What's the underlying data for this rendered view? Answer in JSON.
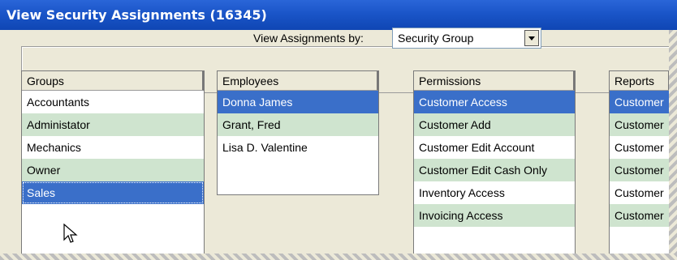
{
  "window": {
    "title": "View Security Assignments (16345)"
  },
  "view": {
    "label": "View Assignments by:",
    "selected": "Security Group"
  },
  "groups": {
    "header": "Groups",
    "items": [
      "Accountants",
      "Administator",
      "Mechanics",
      "Owner",
      "Sales"
    ]
  },
  "employees": {
    "header": "Employees",
    "items": [
      "Donna James",
      "Grant, Fred",
      "Lisa D. Valentine"
    ]
  },
  "permissions": {
    "header": "Permissions",
    "items": [
      "Customer Access",
      "Customer Add",
      "Customer Edit Account",
      "Customer Edit Cash Only",
      "Inventory Access",
      "Invoicing Access"
    ]
  },
  "reports": {
    "header": "Reports",
    "items": [
      "Customer",
      "Customer",
      "Customer",
      "Customer",
      "Customer",
      "Customer"
    ]
  }
}
